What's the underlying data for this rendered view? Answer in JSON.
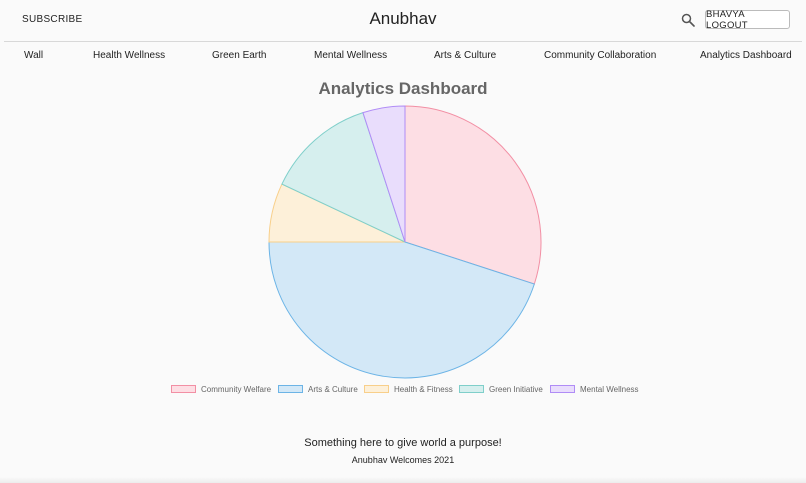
{
  "header": {
    "subscribe_label": "SUBSCRIBE",
    "title": "Anubhav",
    "logout_label": "BHAVYA LOGOUT"
  },
  "nav": {
    "items": [
      {
        "label": "Wall"
      },
      {
        "label": "Health Wellness"
      },
      {
        "label": "Green Earth"
      },
      {
        "label": "Mental Wellness"
      },
      {
        "label": "Arts & Culture"
      },
      {
        "label": "Community Collaboration"
      },
      {
        "label": "Analytics Dashboard"
      }
    ]
  },
  "icons": {
    "search": "search-icon"
  },
  "chart_data": {
    "type": "pie",
    "title": "Analytics Dashboard",
    "categories": [
      "Community Welfare",
      "Arts & Culture",
      "Health & Fitness",
      "Green Initiative",
      "Mental Wellness"
    ],
    "values": [
      30,
      45,
      7,
      13,
      5
    ],
    "fill_colors": [
      "#fddee4",
      "#d3e8f7",
      "#fdf0d9",
      "#d6efee",
      "#e9ddfc"
    ],
    "border_colors": [
      "#f28fa4",
      "#6cb4e6",
      "#f8cf8a",
      "#7fcfca",
      "#b08cf6"
    ],
    "legend_position": "bottom"
  },
  "footer": {
    "tagline": "Something here to give world a purpose!",
    "credit": "Anubhav Welcomes 2021"
  }
}
